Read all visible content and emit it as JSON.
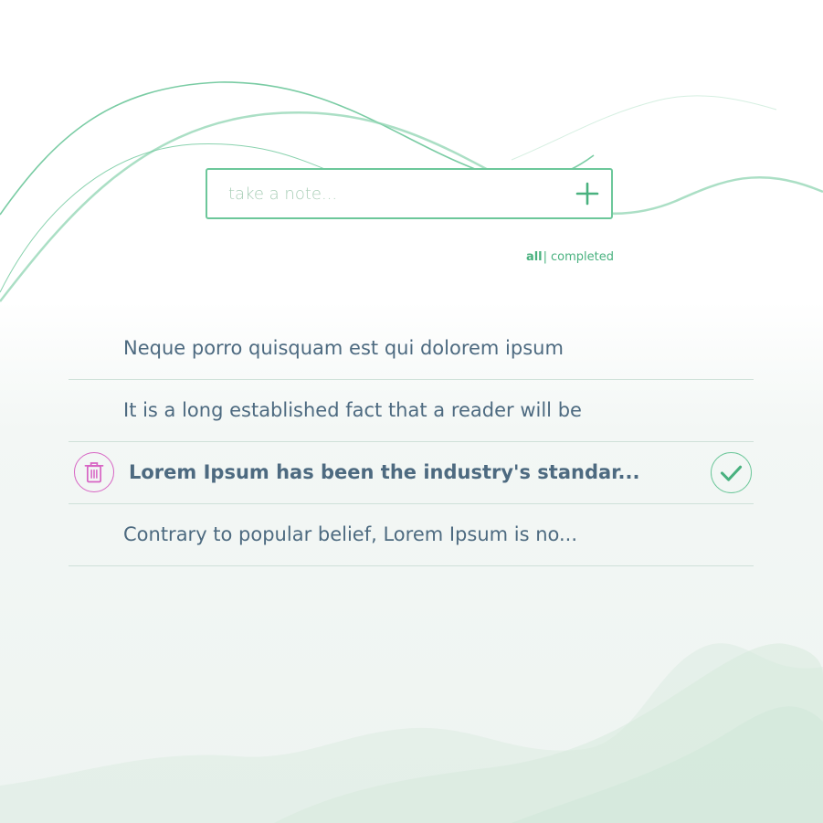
{
  "input": {
    "placeholder": "take a note...",
    "value": ""
  },
  "add_icon": "plus-icon",
  "filters": {
    "all_label": "all",
    "separator": "|",
    "completed_label": "completed",
    "active": "all"
  },
  "notes": [
    {
      "text": "Neque porro quisquam est qui dolorem ipsum",
      "hovered": false
    },
    {
      "text": "It is a long established fact that a reader will be",
      "hovered": false
    },
    {
      "text": "Lorem Ipsum has been the industry's standar...",
      "hovered": true
    },
    {
      "text": "Contrary to popular belief, Lorem Ipsum is no...",
      "hovered": false
    }
  ],
  "icons": {
    "delete": "trash-icon",
    "complete": "checkmark-icon"
  },
  "colors": {
    "accent_green": "#49b17f",
    "input_border": "#6cc79a",
    "delete_pink": "#d765c4",
    "note_text": "#4d6a80",
    "divider": "#cfe1d9",
    "placeholder": "#a9ceb7"
  }
}
